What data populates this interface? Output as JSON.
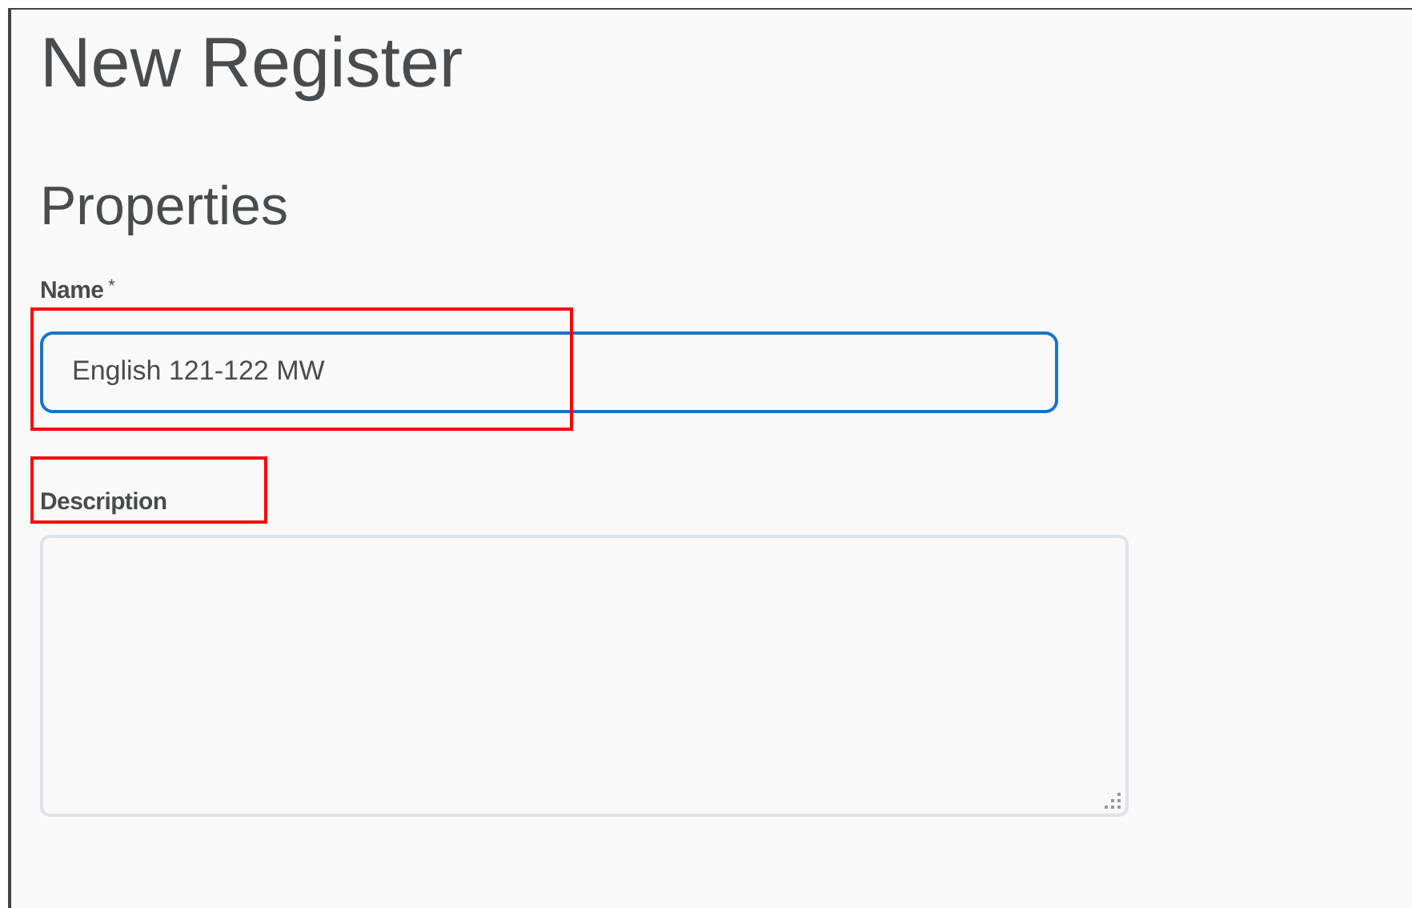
{
  "page_title": "New Register",
  "section_title": "Properties",
  "name_field": {
    "label": "Name",
    "required_mark": "*",
    "value": "English 121-122 MW",
    "focused": true,
    "highlighted": true
  },
  "description_field": {
    "label": "Description",
    "label_highlighted": true
  }
}
